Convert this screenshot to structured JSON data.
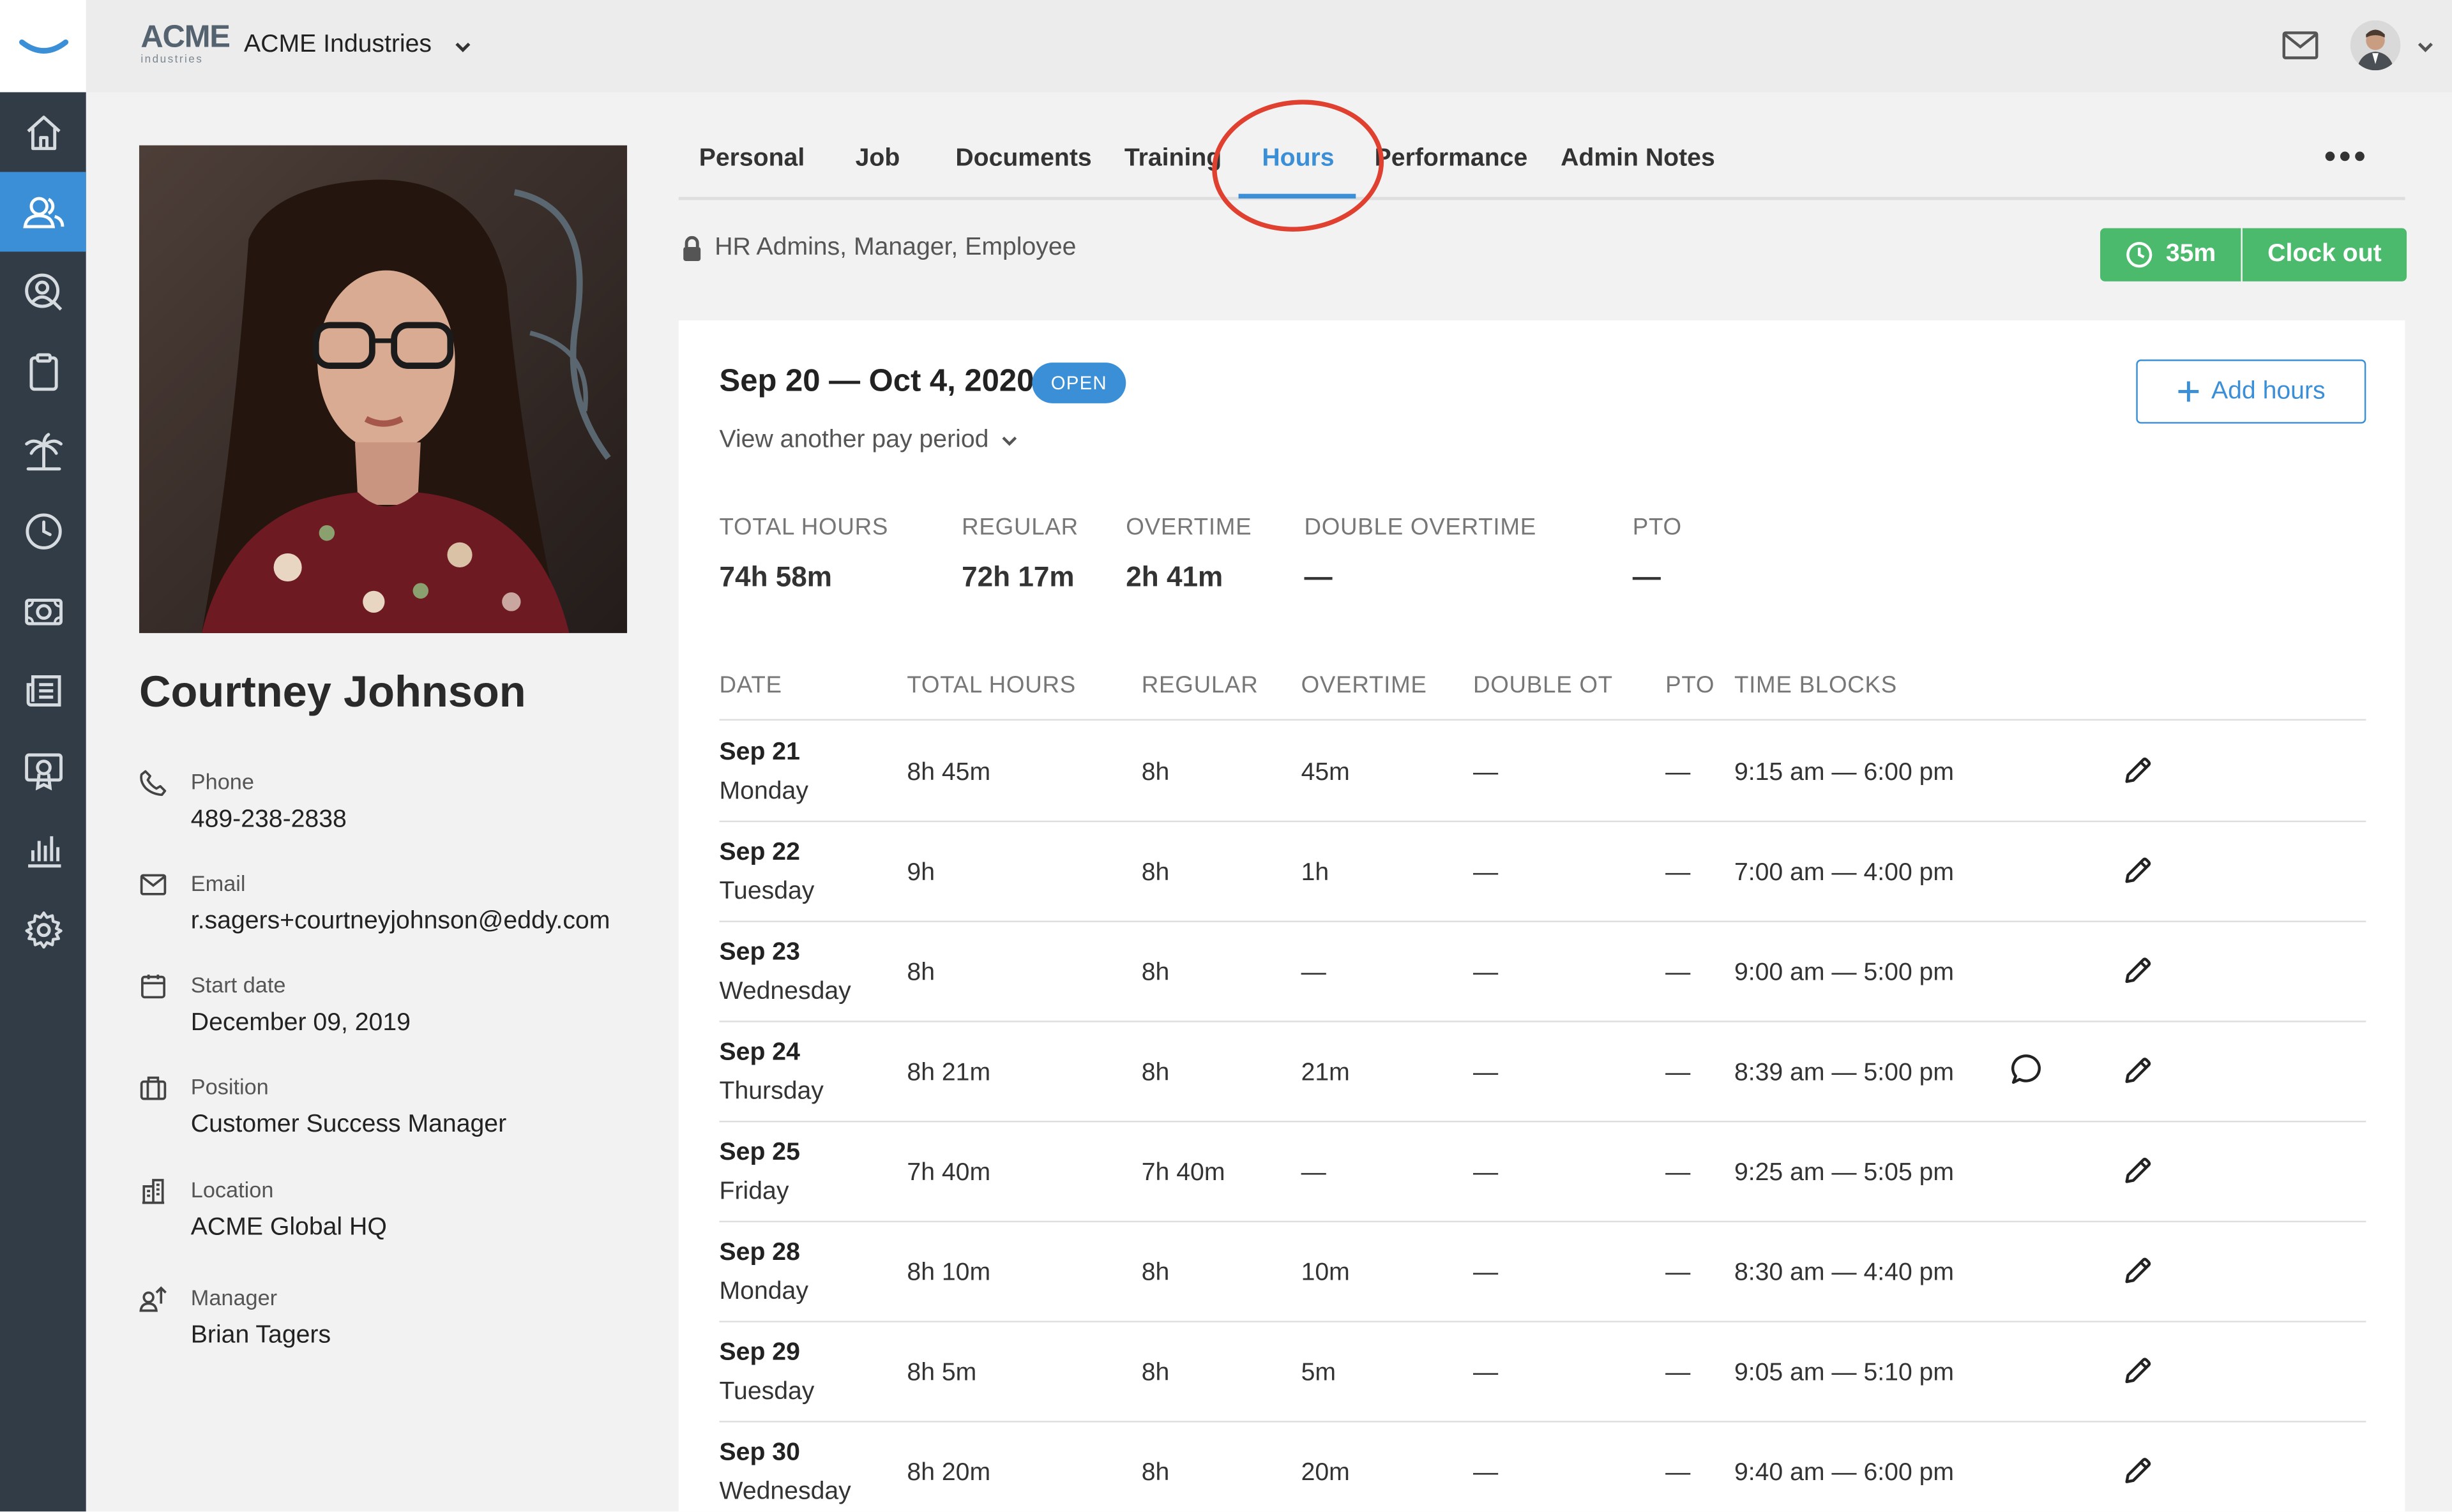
{
  "company": {
    "logo_big": "ACME",
    "logo_small": "industries",
    "name": "ACME Industries"
  },
  "sidebar": {
    "items": [
      {
        "icon": "home-icon"
      },
      {
        "icon": "people-icon",
        "active": true
      },
      {
        "icon": "person-search-icon"
      },
      {
        "icon": "clipboard-icon"
      },
      {
        "icon": "palm-tree-icon"
      },
      {
        "icon": "clock-icon"
      },
      {
        "icon": "money-icon"
      },
      {
        "icon": "news-icon"
      },
      {
        "icon": "certificate-icon"
      },
      {
        "icon": "bar-chart-icon"
      },
      {
        "icon": "gear-icon"
      }
    ]
  },
  "profile": {
    "name": "Courtney Johnson",
    "fields": [
      {
        "label": "Phone",
        "value": "489-238-2838",
        "icon": "phone-icon"
      },
      {
        "label": "Email",
        "value": "r.sagers+courtneyjohnson@eddy.com",
        "icon": "mail-icon"
      },
      {
        "label": "Start date",
        "value": "December 09, 2019",
        "icon": "calendar-icon"
      },
      {
        "label": "Position",
        "value": "Customer Success Manager",
        "icon": "briefcase-icon"
      },
      {
        "label": "Location",
        "value": "ACME Global HQ",
        "icon": "building-icon"
      },
      {
        "label": "Manager",
        "value": "Brian Tagers",
        "icon": "manager-icon"
      }
    ]
  },
  "tabs": [
    "Personal",
    "Job",
    "Documents",
    "Training",
    "Hours",
    "Performance",
    "Admin Notes"
  ],
  "active_tab": "Hours",
  "permissions": "HR Admins, Manager, Employee",
  "clock": {
    "timer": "35m",
    "action": "Clock out"
  },
  "period": {
    "range": "Sep 20 — Oct 4, 2020",
    "status": "OPEN",
    "view_another": "View another pay period",
    "add_hours": "Add hours"
  },
  "summary": [
    {
      "label": "TOTAL HOURS",
      "value": "74h 58m"
    },
    {
      "label": "REGULAR",
      "value": "72h 17m"
    },
    {
      "label": "OVERTIME",
      "value": "2h 41m"
    },
    {
      "label": "DOUBLE OVERTIME",
      "value": "—"
    },
    {
      "label": "PTO",
      "value": "—"
    }
  ],
  "table": {
    "headers": [
      "DATE",
      "TOTAL HOURS",
      "REGULAR",
      "OVERTIME",
      "DOUBLE OT",
      "PTO",
      "TIME BLOCKS"
    ],
    "rows": [
      {
        "date": "Sep 21",
        "day": "Monday",
        "total": "8h 45m",
        "regular": "8h",
        "overtime": "45m",
        "double_ot": "—",
        "pto": "—",
        "blocks": "9:15 am — 6:00 pm"
      },
      {
        "date": "Sep 22",
        "day": "Tuesday",
        "total": "9h",
        "regular": "8h",
        "overtime": "1h",
        "double_ot": "—",
        "pto": "—",
        "blocks": "7:00 am — 4:00 pm"
      },
      {
        "date": "Sep 23",
        "day": "Wednesday",
        "total": "8h",
        "regular": "8h",
        "overtime": "—",
        "double_ot": "—",
        "pto": "—",
        "blocks": "9:00 am — 5:00 pm"
      },
      {
        "date": "Sep 24",
        "day": "Thursday",
        "total": "8h 21m",
        "regular": "8h",
        "overtime": "21m",
        "double_ot": "—",
        "pto": "—",
        "blocks": "8:39 am — 5:00 pm",
        "has_comment": true
      },
      {
        "date": "Sep 25",
        "day": "Friday",
        "total": "7h 40m",
        "regular": "7h 40m",
        "overtime": "—",
        "double_ot": "—",
        "pto": "—",
        "blocks": "9:25 am — 5:05 pm"
      },
      {
        "date": "Sep 28",
        "day": "Monday",
        "total": "8h 10m",
        "regular": "8h",
        "overtime": "10m",
        "double_ot": "—",
        "pto": "—",
        "blocks": "8:30 am — 4:40 pm"
      },
      {
        "date": "Sep 29",
        "day": "Tuesday",
        "total": "8h 5m",
        "regular": "8h",
        "overtime": "5m",
        "double_ot": "—",
        "pto": "—",
        "blocks": "9:05 am — 5:10 pm"
      },
      {
        "date": "Sep 30",
        "day": "Wednesday",
        "total": "8h 20m",
        "regular": "8h",
        "overtime": "20m",
        "double_ot": "—",
        "pto": "—",
        "blocks": "9:40 am — 6:00 pm"
      }
    ]
  },
  "colors": {
    "accent": "#3a8fd7",
    "success": "#4cba6c",
    "sidebar": "#323c46",
    "annotation": "#e0402f"
  }
}
